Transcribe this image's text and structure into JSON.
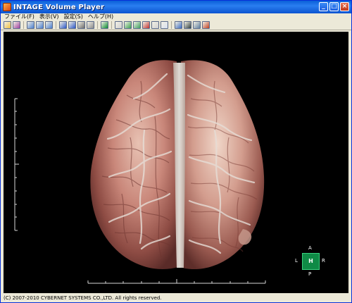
{
  "window": {
    "title": "INTAGE Volume Player"
  },
  "menu": {
    "items": [
      "ファイル(F)",
      "表示(V)",
      "設定(S)",
      "ヘルプ(H)"
    ]
  },
  "toolbar": {
    "tools": [
      {
        "icon": "open-folder-icon",
        "color": "#f0c040"
      },
      {
        "icon": "save-icon",
        "color": "#a040a0"
      },
      {
        "icon": "layout-single-icon",
        "color": "#4a7fd0"
      },
      {
        "icon": "layout-two-icon",
        "color": "#4a7fd0"
      },
      {
        "icon": "layout-four-icon",
        "color": "#4a7fd0"
      },
      {
        "icon": "cube-blue-icon",
        "color": "#2a56c8"
      },
      {
        "icon": "cube-blue2-icon",
        "color": "#2a56c8"
      },
      {
        "icon": "cube-gray-icon",
        "color": "#6a6a6a"
      },
      {
        "icon": "cube-gray2-icon",
        "color": "#8a8a8a"
      },
      {
        "icon": "green-square-icon",
        "color": "#0a8a30"
      },
      {
        "icon": "mip-icon",
        "color": "#d0d0d0"
      },
      {
        "icon": "cube-green-icon",
        "color": "#3aa050"
      },
      {
        "icon": "cube-wire-icon",
        "color": "#40a060"
      },
      {
        "icon": "axes-icon",
        "color": "#c03030"
      },
      {
        "icon": "slice-icon",
        "color": "#d0d0d0"
      },
      {
        "icon": "window-icon",
        "color": "#d8e0f0"
      },
      {
        "icon": "rotate-cube-icon",
        "color": "#3a6ac0"
      },
      {
        "icon": "annotation-icon",
        "color": "#304040"
      },
      {
        "icon": "monitor-icon",
        "color": "#6080a0"
      },
      {
        "icon": "color-palette-icon",
        "color": "#c04020"
      }
    ]
  },
  "orientation": {
    "top": "A",
    "left": "L",
    "right": "R",
    "bottom": "P",
    "center": "H"
  },
  "status_bar": {
    "text": "(C) 2007-2010 CYBERNET SYSTEMS CO.,LTD. All rights reserved."
  }
}
